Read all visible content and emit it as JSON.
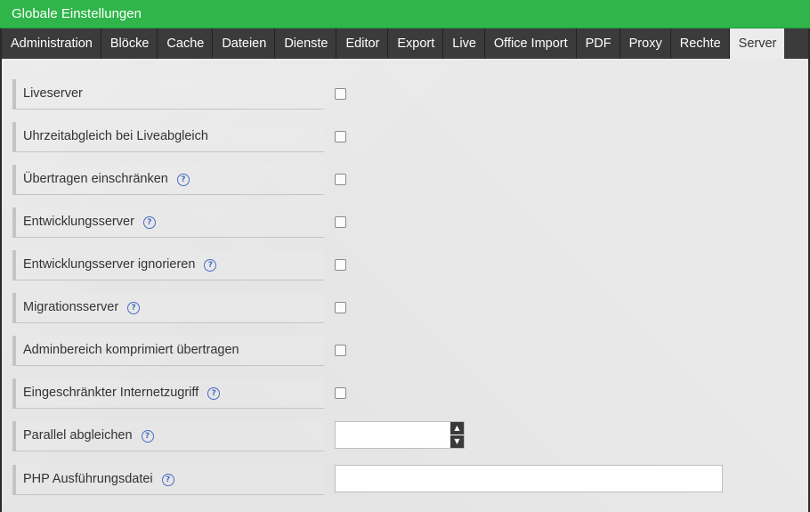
{
  "window": {
    "title": "Globale Einstellungen"
  },
  "tabs": [
    {
      "label": "Administration"
    },
    {
      "label": "Blöcke"
    },
    {
      "label": "Cache"
    },
    {
      "label": "Dateien"
    },
    {
      "label": "Dienste"
    },
    {
      "label": "Editor"
    },
    {
      "label": "Export"
    },
    {
      "label": "Live"
    },
    {
      "label": "Office Import"
    },
    {
      "label": "PDF"
    },
    {
      "label": "Proxy"
    },
    {
      "label": "Rechte"
    },
    {
      "label": "Server",
      "active": true
    }
  ],
  "settings": [
    {
      "label": "Liveserver",
      "help": false,
      "type": "checkbox",
      "checked": false
    },
    {
      "label": "Uhrzeitabgleich bei Liveabgleich",
      "help": false,
      "type": "checkbox",
      "checked": false
    },
    {
      "label": "Übertragen einschränken",
      "help": true,
      "type": "checkbox",
      "checked": false
    },
    {
      "label": "Entwicklungsserver",
      "help": true,
      "type": "checkbox",
      "checked": false
    },
    {
      "label": "Entwicklungsserver ignorieren",
      "help": true,
      "type": "checkbox",
      "checked": false
    },
    {
      "label": "Migrationsserver",
      "help": true,
      "type": "checkbox",
      "checked": false
    },
    {
      "label": "Adminbereich komprimiert übertragen",
      "help": false,
      "type": "checkbox",
      "checked": false
    },
    {
      "label": "Eingeschränkter Internetzugriff",
      "help": true,
      "type": "checkbox",
      "checked": false
    },
    {
      "label": "Parallel abgleichen",
      "help": true,
      "type": "number",
      "value": ""
    },
    {
      "label": "PHP Ausführungsdatei",
      "help": true,
      "type": "text",
      "value": ""
    }
  ],
  "icons": {
    "help": "question-circle-icon",
    "help_glyph": "?",
    "spin_up": "▲",
    "spin_down": "▼"
  },
  "colors": {
    "titlebar": "#2fb54a",
    "tabbar": "#3b3b3b",
    "content": "#e9e9e9",
    "help": "#4a6cc8"
  }
}
